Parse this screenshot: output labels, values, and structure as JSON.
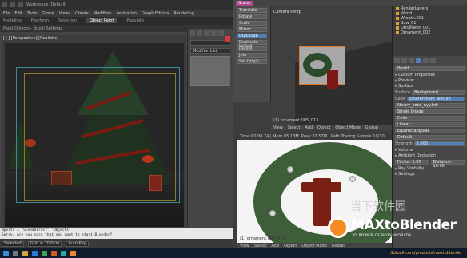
{
  "max": {
    "title_left": "Workspace: Default",
    "menu": [
      "File",
      "Edit",
      "Tools",
      "Group",
      "Views",
      "Create",
      "Modifiers",
      "Animation",
      "Graph Editors",
      "Rendering"
    ],
    "tabs": [
      "Modeling",
      "Freeform",
      "Selection",
      "Object Paint",
      "Populate"
    ],
    "active_tab": "Object Paint",
    "subbar": "Paint Objects · Brush Settings",
    "viewport_label": "[+] [Perspective] [Realistic]",
    "modifier_list": "Modifier List",
    "listener_lines": [
      "mports = \"SceneDirect\" \"Objects\"",
      "Sorry, Are you sure that you want to start Blender?"
    ],
    "status_select": "Selected",
    "status_grid": "Grid = 10.0cm",
    "status_autokey": "Auto Key"
  },
  "blender": {
    "top_tags": [
      "Scene"
    ],
    "toolshelf": [
      "Translate",
      "Rotate",
      "Scale",
      "Mirror",
      "Duplicate",
      "Duplicate Linked",
      "Delete",
      "Join",
      "Set Origin"
    ],
    "toolshelf_hi": 4,
    "viewport_label": "Camera Persp",
    "viewport_foot": [
      "View",
      "Select",
      "Add",
      "Object",
      "Object Mode",
      "Global"
    ],
    "viewport_obj": "(1) ornament.005_013",
    "render_head": "Time:00:08.74 | Mem:85.13M, Peak:87.57M | Path Tracing Sample 10/10",
    "render_obj": "(1) ornament.005_013",
    "render_foot": [
      "View",
      "Select",
      "Add",
      "Object",
      "Object Mode",
      "Global"
    ],
    "outliner": [
      "RenderLayers",
      "World",
      "Wreath.001",
      "Bow_01",
      "Ornament_001",
      "Ornament_002"
    ],
    "props_tab_label": "World",
    "props": {
      "world_name": "World",
      "sections": [
        "Custom Properties",
        "Preview",
        "Surface"
      ],
      "surface_label": "Surface",
      "surface_value": "Background",
      "color_label": "Color",
      "color_value": "Environment Texture",
      "texture_name": "library_coco_nyy.hdr",
      "single_image": "Single Image",
      "color_space": "Color",
      "linear": "Linear",
      "projection": "Equirectangular",
      "vector": "Default",
      "strength_label": "Strength",
      "strength_value": "1.000",
      "volume": "Volume",
      "ao_label": "Ambient Occlusion",
      "factor": "Factor: 1.00",
      "distance": "Distance: 10.00",
      "more": [
        "Ray Visibility",
        "Settings"
      ]
    }
  },
  "brand": {
    "logo": "MAXtoBlender",
    "tagline": "3D POWER OF BOTH WORLDS",
    "watermark": "当下软件园",
    "url": "3dtoall.com/products/maxtoblender"
  },
  "colors": {
    "accent_blue": "#4f7fb4",
    "brand_orange": "#f58a20",
    "max_bg": "#444444",
    "blender_bg": "#3d3d3d"
  }
}
